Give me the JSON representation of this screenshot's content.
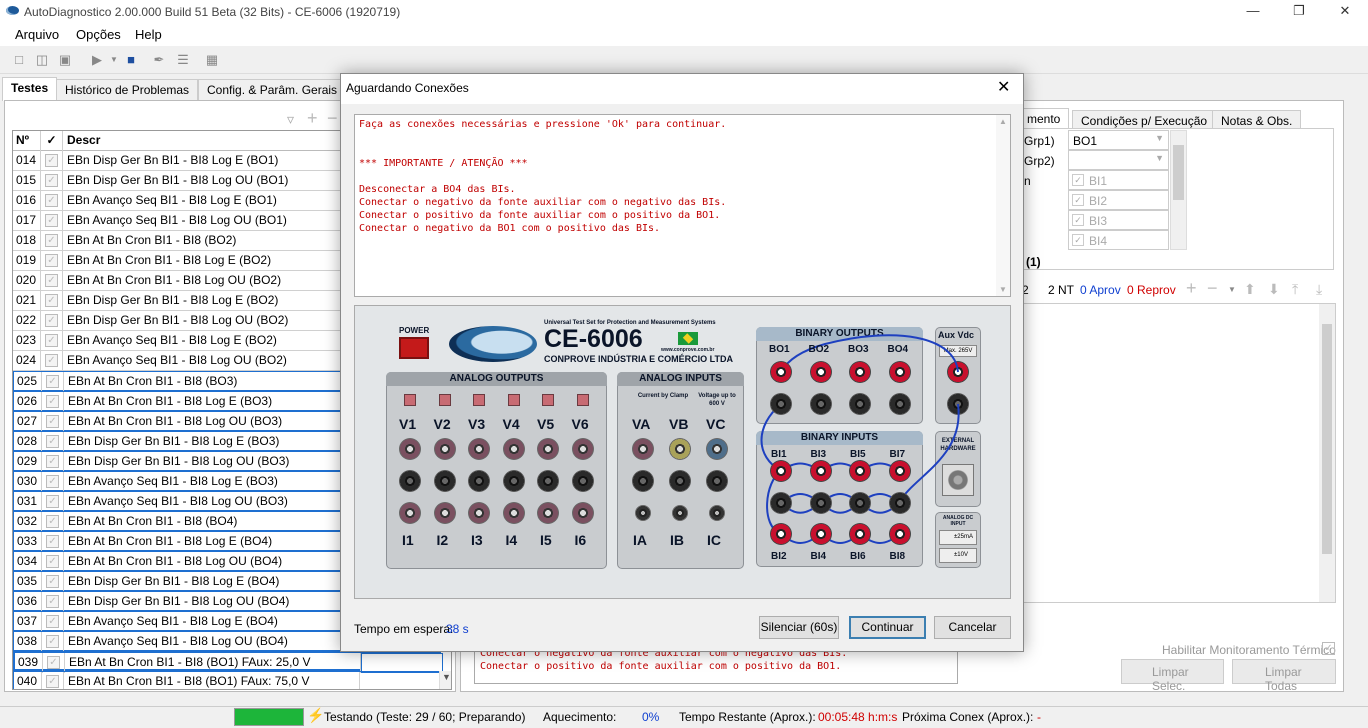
{
  "window": {
    "title": "AutoDiagnostico 2.00.000 Build 51 Beta (32 Bits) - CE-6006 (1920719)"
  },
  "menu": [
    "Arquivo",
    "Opções",
    "Help"
  ],
  "left_tabs": [
    "Testes",
    "Histórico de Problemas",
    "Config. & Parâm. Gerais"
  ],
  "grid": {
    "headers": {
      "num": "Nº",
      "check": "✓",
      "desc": "Descr"
    },
    "rows": [
      {
        "num": "014",
        "desc": "EBn Disp Ger Bn BI1 - BI8 Log E (BO1)"
      },
      {
        "num": "015",
        "desc": "EBn Disp Ger Bn BI1 - BI8 Log OU (BO1)"
      },
      {
        "num": "016",
        "desc": "EBn Avanço Seq BI1 - BI8 Log E (BO1)"
      },
      {
        "num": "017",
        "desc": "EBn Avanço Seq BI1 - BI8 Log OU (BO1)"
      },
      {
        "num": "018",
        "desc": "EBn At Bn Cron BI1 - BI8 (BO2)"
      },
      {
        "num": "019",
        "desc": "EBn At Bn Cron BI1 - BI8 Log E (BO2)"
      },
      {
        "num": "020",
        "desc": "EBn At Bn Cron BI1 - BI8 Log OU (BO2)"
      },
      {
        "num": "021",
        "desc": "EBn Disp Ger Bn BI1 - BI8 Log E (BO2)"
      },
      {
        "num": "022",
        "desc": "EBn Disp Ger Bn BI1 - BI8 Log OU (BO2)"
      },
      {
        "num": "023",
        "desc": "EBn Avanço Seq BI1 - BI8 Log E (BO2)"
      },
      {
        "num": "024",
        "desc": "EBn Avanço Seq BI1 - BI8 Log OU (BO2)"
      },
      {
        "num": "025",
        "desc": "EBn At Bn Cron BI1 - BI8 (BO3)"
      },
      {
        "num": "026",
        "desc": "EBn At Bn Cron BI1 - BI8 Log E (BO3)"
      },
      {
        "num": "027",
        "desc": "EBn At Bn Cron BI1 - BI8 Log OU (BO3)"
      },
      {
        "num": "028",
        "desc": "EBn Disp Ger Bn BI1 - BI8 Log E (BO3)"
      },
      {
        "num": "029",
        "desc": "EBn Disp Ger Bn BI1 - BI8 Log OU (BO3)"
      },
      {
        "num": "030",
        "desc": "EBn Avanço Seq BI1 - BI8 Log E (BO3)"
      },
      {
        "num": "031",
        "desc": "EBn Avanço Seq BI1 - BI8 Log OU (BO3)"
      },
      {
        "num": "032",
        "desc": "EBn At Bn Cron BI1 - BI8 (BO4)"
      },
      {
        "num": "033",
        "desc": "EBn At Bn Cron BI1 - BI8 Log E (BO4)"
      },
      {
        "num": "034",
        "desc": "EBn At Bn Cron BI1 - BI8 Log OU (BO4)"
      },
      {
        "num": "035",
        "desc": "EBn Disp Ger Bn BI1 - BI8 Log E (BO4)"
      },
      {
        "num": "036",
        "desc": "EBn Disp Ger Bn BI1 - BI8 Log OU (BO4)"
      },
      {
        "num": "037",
        "desc": "EBn Avanço Seq BI1 - BI8 Log E (BO4)"
      },
      {
        "num": "038",
        "desc": "EBn Avanço Seq BI1 - BI8 Log OU (BO4)"
      },
      {
        "num": "039",
        "desc": "EBn At Bn Cron BI1 - BI8 (BO1) FAux: 25,0 V"
      },
      {
        "num": "040",
        "desc": "EBn At Bn Cron BI1 - BI8 (BO1) FAux: 75,0 V"
      }
    ]
  },
  "right": {
    "tabs": [
      "mento",
      "Condições p/ Execução",
      "Notas & Obs."
    ],
    "params": [
      {
        "label": "Grp1)",
        "value": "BO1"
      },
      {
        "label": "Grp2)",
        "value": ""
      },
      {
        "label": "n",
        "value": ""
      }
    ],
    "bi_items": [
      "BI1",
      "BI2",
      "BI3",
      "BI4"
    ],
    "count_label": "(1)",
    "stats": {
      "a": "2",
      "nt": "2 NT",
      "aprov": "0 Aprov",
      "reprov": "0 Reprov"
    },
    "monitor_label": "Habilitar Monitoramento Térmico",
    "limpar_sel": "Limpar Selec.",
    "limpar_todas": "Limpar Todas",
    "bottom_msg": "Conectar o negativo da fonte auxiliar com o negativo das BIs.\nConectar o positivo da fonte auxiliar com o positivo da BO1."
  },
  "dialog": {
    "title": "Aguardando Conexões",
    "message": "Faça as conexões necessárias e pressione 'Ok' para continuar.\n\n\n*** IMPORTANTE / ATENÇÃO ***\n\nDesconectar a BO4 das BIs.\nConectar o negativo da fonte auxiliar com o negativo das BIs.\nConectar o positivo da fonte auxiliar com o positivo da BO1.\nConectar o negativo da BO1 com o positivo das BIs.",
    "wait_label": "Tempo em espera:",
    "wait_value": "38 s",
    "btn_silence": "Silenciar (60s)",
    "btn_continue": "Continuar",
    "btn_cancel": "Cancelar"
  },
  "device": {
    "model": "CE-6006",
    "subtitle": "Universal Test Set for Protection and Measurement Systems",
    "company": "CONPROVE INDÚSTRIA E COMÉRCIO LTDA",
    "url": "www.conprove.com.br",
    "power": "POWER",
    "analog_outputs": "ANALOG OUTPUTS",
    "analog_inputs": "ANALOG INPUTS",
    "binary_outputs": "BINARY OUTPUTS",
    "binary_inputs": "BINARY INPUTS",
    "aux_vdc": "Aux Vdc",
    "max_v": "Max. 265V",
    "external_hw": "EXTERNAL HARDWARE",
    "analog_dc": "ANALOG DC INPUT",
    "dc_ma": "±25mA",
    "dc_v": "±10V",
    "current_clamp": "Current by Clamp",
    "voltage_600": "Voltage up to 600 V",
    "v_labels": [
      "V1",
      "V2",
      "V3",
      "V4",
      "V5",
      "V6"
    ],
    "i_labels": [
      "I1",
      "I2",
      "I3",
      "I4",
      "I5",
      "I6"
    ],
    "va_labels": [
      "VA",
      "VB",
      "VC"
    ],
    "ia_labels": [
      "IA",
      "IB",
      "IC"
    ],
    "bo_labels": [
      "BO1",
      "BO2",
      "BO3",
      "BO4"
    ],
    "bi_top": [
      "BI1",
      "BI3",
      "BI5",
      "BI7"
    ],
    "bi_bot": [
      "BI2",
      "BI4",
      "BI6",
      "BI8"
    ]
  },
  "status": {
    "testing": "Testando (Teste: 29 / 60; Preparando)",
    "heating_label": "Aquecimento:",
    "heating_value": "0%",
    "remaining_label": "Tempo Restante (Aprox.):",
    "remaining_value": "00:05:48 h:m:s",
    "next_label": "Próxima Conex (Aprox.):",
    "next_value": "-"
  },
  "colors": {
    "accent": "#1e6fd0",
    "error_text": "#c00000",
    "progress": "#1db53a"
  }
}
